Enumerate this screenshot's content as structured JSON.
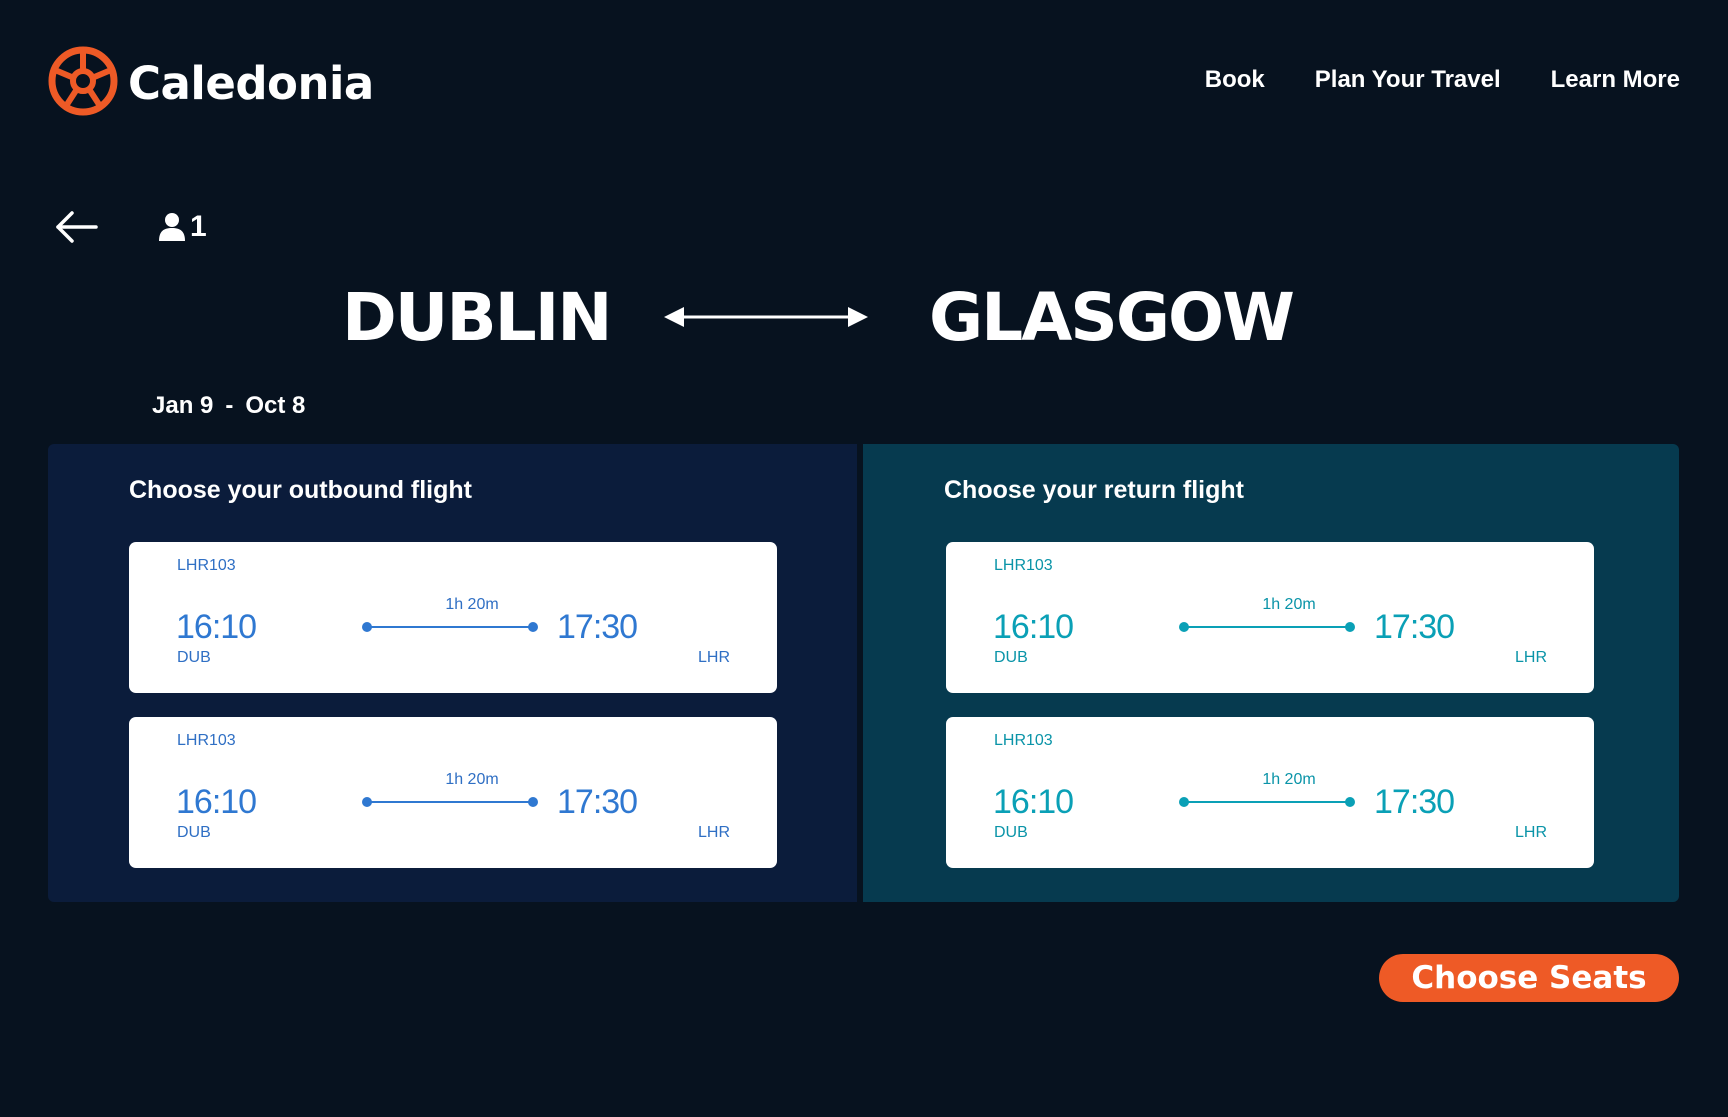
{
  "brand": {
    "name": "Caledonia",
    "logo_icon": "wheel-logo-icon",
    "accent_color": "#ee5a26"
  },
  "nav": {
    "items": [
      {
        "label": "Book"
      },
      {
        "label": "Plan Your Travel"
      },
      {
        "label": "Learn More"
      }
    ]
  },
  "toolbar": {
    "back_icon": "arrow-left-icon",
    "passenger_icon": "person-icon",
    "passenger_count": "1"
  },
  "route": {
    "origin": "DUBLIN",
    "destination": "GLASGOW",
    "arrow_icon": "double-arrow-icon"
  },
  "dates": {
    "depart": "Jan 9",
    "separator": "-",
    "return": "Oct 8"
  },
  "outbound": {
    "title": "Choose your outbound flight",
    "color": "#2f78d1",
    "panel_color": "#0b1c3b",
    "flights": [
      {
        "flight_no": "LHR103",
        "depart_time": "16:10",
        "arrive_time": "17:30",
        "duration": "1h 20m",
        "from": "DUB",
        "to": "LHR"
      },
      {
        "flight_no": "LHR103",
        "depart_time": "16:10",
        "arrive_time": "17:30",
        "duration": "1h 20m",
        "from": "DUB",
        "to": "LHR"
      }
    ]
  },
  "return": {
    "title": "Choose your return flight",
    "color": "#0aa0b6",
    "panel_color": "#063a4f",
    "flights": [
      {
        "flight_no": "LHR103",
        "depart_time": "16:10",
        "arrive_time": "17:30",
        "duration": "1h 20m",
        "from": "DUB",
        "to": "LHR"
      },
      {
        "flight_no": "LHR103",
        "depart_time": "16:10",
        "arrive_time": "17:30",
        "duration": "1h 20m",
        "from": "DUB",
        "to": "LHR"
      }
    ]
  },
  "cta": {
    "label": "Choose Seats"
  }
}
